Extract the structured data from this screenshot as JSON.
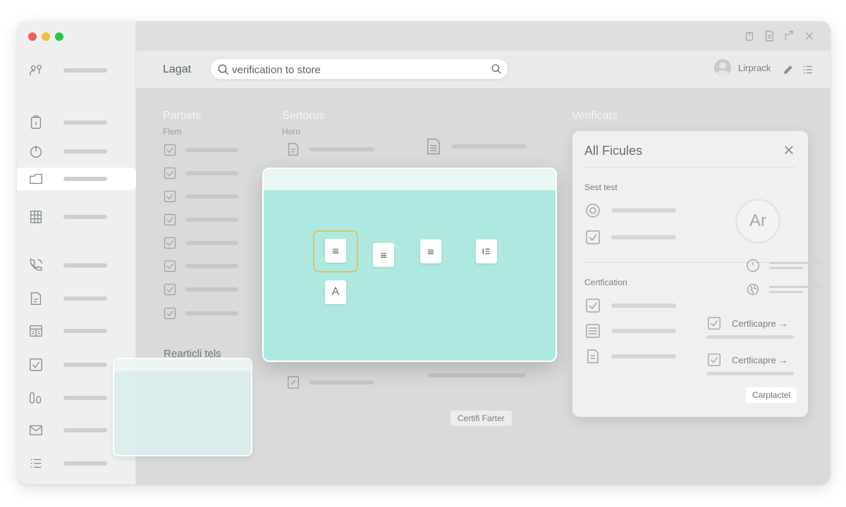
{
  "toolbar": {
    "brand": "Lagat",
    "search_value": "verification to store",
    "user_name": "Lirprack"
  },
  "columns": {
    "left": {
      "title": "Partiets",
      "subtitle": "Flem"
    },
    "middle": {
      "title": "Sertorus",
      "subtitle": "Horn"
    },
    "right": {
      "title": "Verificats"
    }
  },
  "drop_panel": {
    "file_letter": "A"
  },
  "ghost_panel": {
    "label": "Rearticli tels"
  },
  "middle_button": "Certifi Farter",
  "dialog": {
    "title": "All Ficules",
    "section1": "Sest test",
    "section2": "Certfication",
    "badge": "Ar",
    "cert_item_1": "Certlicapre →",
    "cert_item_2": "Certlicapre →",
    "cancel_label": "Carplactel"
  },
  "colors": {
    "accent": "#aee9e1",
    "selection": "#d9c46a",
    "traffic_red": "#ee5f57",
    "traffic_yellow": "#f4bd3a",
    "traffic_green": "#2ec24a"
  },
  "icons": {
    "sidebar": [
      "user-settings-icon",
      "clipboard-icon",
      "power-icon",
      "folder-icon",
      "grid-icon",
      "phone-icon",
      "document-icon",
      "table-icon",
      "checkbox-icon",
      "bars-icon",
      "mail-icon",
      "list-icon"
    ]
  }
}
